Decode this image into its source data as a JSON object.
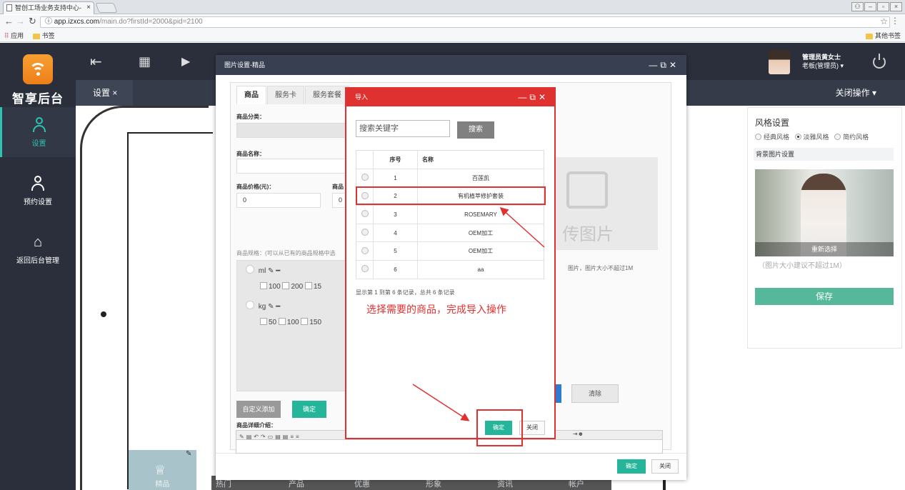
{
  "browser": {
    "tab_title": "智创工场业务支持中心-",
    "url_domain": "app.izxcs.com",
    "url_path": "/main.do?firstId=2000&pid=2100",
    "bookmarks": [
      "应用",
      "书签"
    ],
    "other_bookmarks": "其他书签"
  },
  "sidebar": {
    "brand": "智享后台",
    "items": [
      {
        "label": "设置",
        "icon": "person-icon",
        "active": true
      },
      {
        "label": "预约设置",
        "icon": "person-icon",
        "active": false
      },
      {
        "label": "返回后台管理",
        "icon": "home-icon",
        "active": false
      }
    ]
  },
  "header": {
    "tab_label": "设置 ×",
    "user_name": "管理员黄女士",
    "user_role": "老板(管理员) ▾",
    "close_ops": "关闭操作 ▾"
  },
  "phone_preview": {
    "crown_label": "精品",
    "bottom_nav": [
      "热门",
      "产品",
      "优惠",
      "形象",
      "资讯",
      "帐户"
    ]
  },
  "right_panel": {
    "title": "风格设置",
    "styles": [
      "经典风格",
      "淡雅风格",
      "简约风格"
    ],
    "selected_style": "淡雅风格",
    "bg_setting": "背景图片设置",
    "reselect": "重新选择",
    "tip": "（图片大小建议不超过1M）",
    "save": "保存"
  },
  "dialog_main": {
    "title": "图片设置-精品",
    "tabs": [
      "商品",
      "服务卡",
      "服务套餐"
    ],
    "category_label": "商品分类：",
    "name_label": "商品名称：",
    "price_label": "商品价格(元)：",
    "price_value": "0",
    "price2_label": "商品",
    "price2_value": "0",
    "spec_label": "商品规格：(可以从已有的商品规格中选",
    "spec_ml": "ml",
    "spec_ml_values": [
      "100",
      "200",
      "15"
    ],
    "spec_kg": "kg",
    "spec_kg_values": [
      "50",
      "100",
      "150"
    ],
    "custom_add": "自定义添加",
    "confirm_small": "确定",
    "detail_label": "商品详细介绍：",
    "upload_text": "传图片",
    "upload_hint": "图片，图片大小不超过1M",
    "clear": "清除",
    "ok": "确定",
    "close": "关闭"
  },
  "dialog_import": {
    "title": "导入",
    "search_placeholder": "搜索关键字",
    "search_btn": "搜索",
    "columns": [
      "序号",
      "名称"
    ],
    "rows": [
      {
        "no": "1",
        "name": "百莲凯"
      },
      {
        "no": "2",
        "name": "有机植萃修护套装"
      },
      {
        "no": "3",
        "name": "ROSEMARY"
      },
      {
        "no": "4",
        "name": "OEM加工"
      },
      {
        "no": "5",
        "name": "OEM加工"
      },
      {
        "no": "6",
        "name": "aa"
      }
    ],
    "page_info": "显示第 1 到第 6 条记录，总共 6 条记录",
    "instruction": "选择需要的商品，完成导入操作",
    "ok": "确定",
    "close": "关闭"
  },
  "colors": {
    "accent": "#25b59a",
    "annotation": "#e03131",
    "sidebar": "#2a2f3b"
  }
}
